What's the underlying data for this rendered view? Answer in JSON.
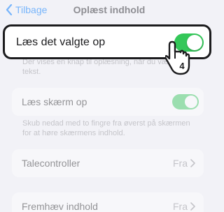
{
  "navbar": {
    "back_label": "Tilbage",
    "title": "Oplæst indhold"
  },
  "speak_selection": {
    "label": "Læs det valgte op",
    "toggle_on": true,
    "footnote": "Der vises en knap til oplæsning, når du vælger tekst."
  },
  "speak_screen": {
    "label": "Læs skærm op",
    "toggle_on": true,
    "footnote": "Skub nedad med to fingre fra øverst på skærmen for at høre skærmens indhold."
  },
  "talecontroller": {
    "label": "Talecontroller",
    "value": "Fra"
  },
  "highlight_content": {
    "label": "Fremhæv indhold",
    "value": "Fra"
  },
  "tutorial": {
    "step_number": "4",
    "icon": "tap-hand-icon"
  },
  "colors": {
    "accent": "#007aff",
    "toggle_on": "#34c759",
    "background": "#f2f2f7"
  }
}
